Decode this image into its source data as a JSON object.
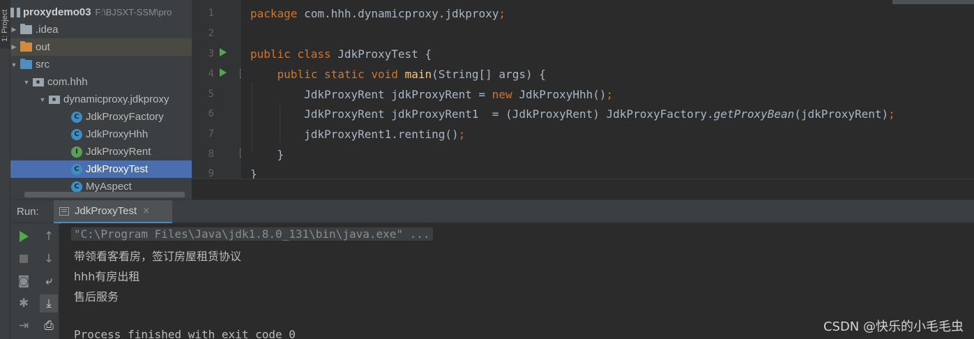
{
  "sidebar": {
    "tab_label": "1: Project"
  },
  "project": {
    "name": "proxydemo03",
    "path": "F:\\BJSXT-SSM\\pro",
    "tree": [
      {
        "label": ".idea",
        "type": "folder-grey"
      },
      {
        "label": "out",
        "type": "folder-orange"
      },
      {
        "label": "src",
        "type": "folder-blue"
      },
      {
        "label": "com.hhh",
        "type": "package"
      },
      {
        "label": "dynamicproxy.jdkproxy",
        "type": "package"
      },
      {
        "label": "JdkProxyFactory",
        "type": "class"
      },
      {
        "label": "JdkProxyHhh",
        "type": "class"
      },
      {
        "label": "JdkProxyRent",
        "type": "interface"
      },
      {
        "label": "JdkProxyTest",
        "type": "class",
        "selected": true
      },
      {
        "label": "MyAspect",
        "type": "class"
      }
    ]
  },
  "editor": {
    "line_numbers": [
      "1",
      "2",
      "3",
      "4",
      "5",
      "6",
      "7",
      "8",
      "9"
    ],
    "lines": [
      "package com.hhh.dynamicproxy.jdkproxy;",
      "",
      "public class JdkProxyTest {",
      "    public static void main(String[] args) {",
      "        JdkProxyRent jdkProxyRent = new JdkProxyHhh();",
      "        JdkProxyRent jdkProxyRent1  = (JdkProxyRent) JdkProxyFactory.getProxyBean(jdkProxyRent);",
      "        jdkProxyRent1.renting();",
      "    }",
      "}"
    ]
  },
  "run": {
    "label": "Run:",
    "tab_label": "JdkProxyTest",
    "tab_close": "×",
    "console": [
      "\"C:\\Program Files\\Java\\jdk1.8.0_131\\bin\\java.exe\" ...",
      "带领看客看房，签订房屋租赁协议",
      "hhh有房出租",
      "售后服务",
      "",
      "Process finished with exit code 0"
    ]
  },
  "watermark": "CSDN @快乐的小毛毛虫",
  "colors": {
    "accent": "#4b6eaf",
    "keyword": "#cc7832",
    "method": "#ffc66d",
    "run_green": "#4fa84a"
  }
}
